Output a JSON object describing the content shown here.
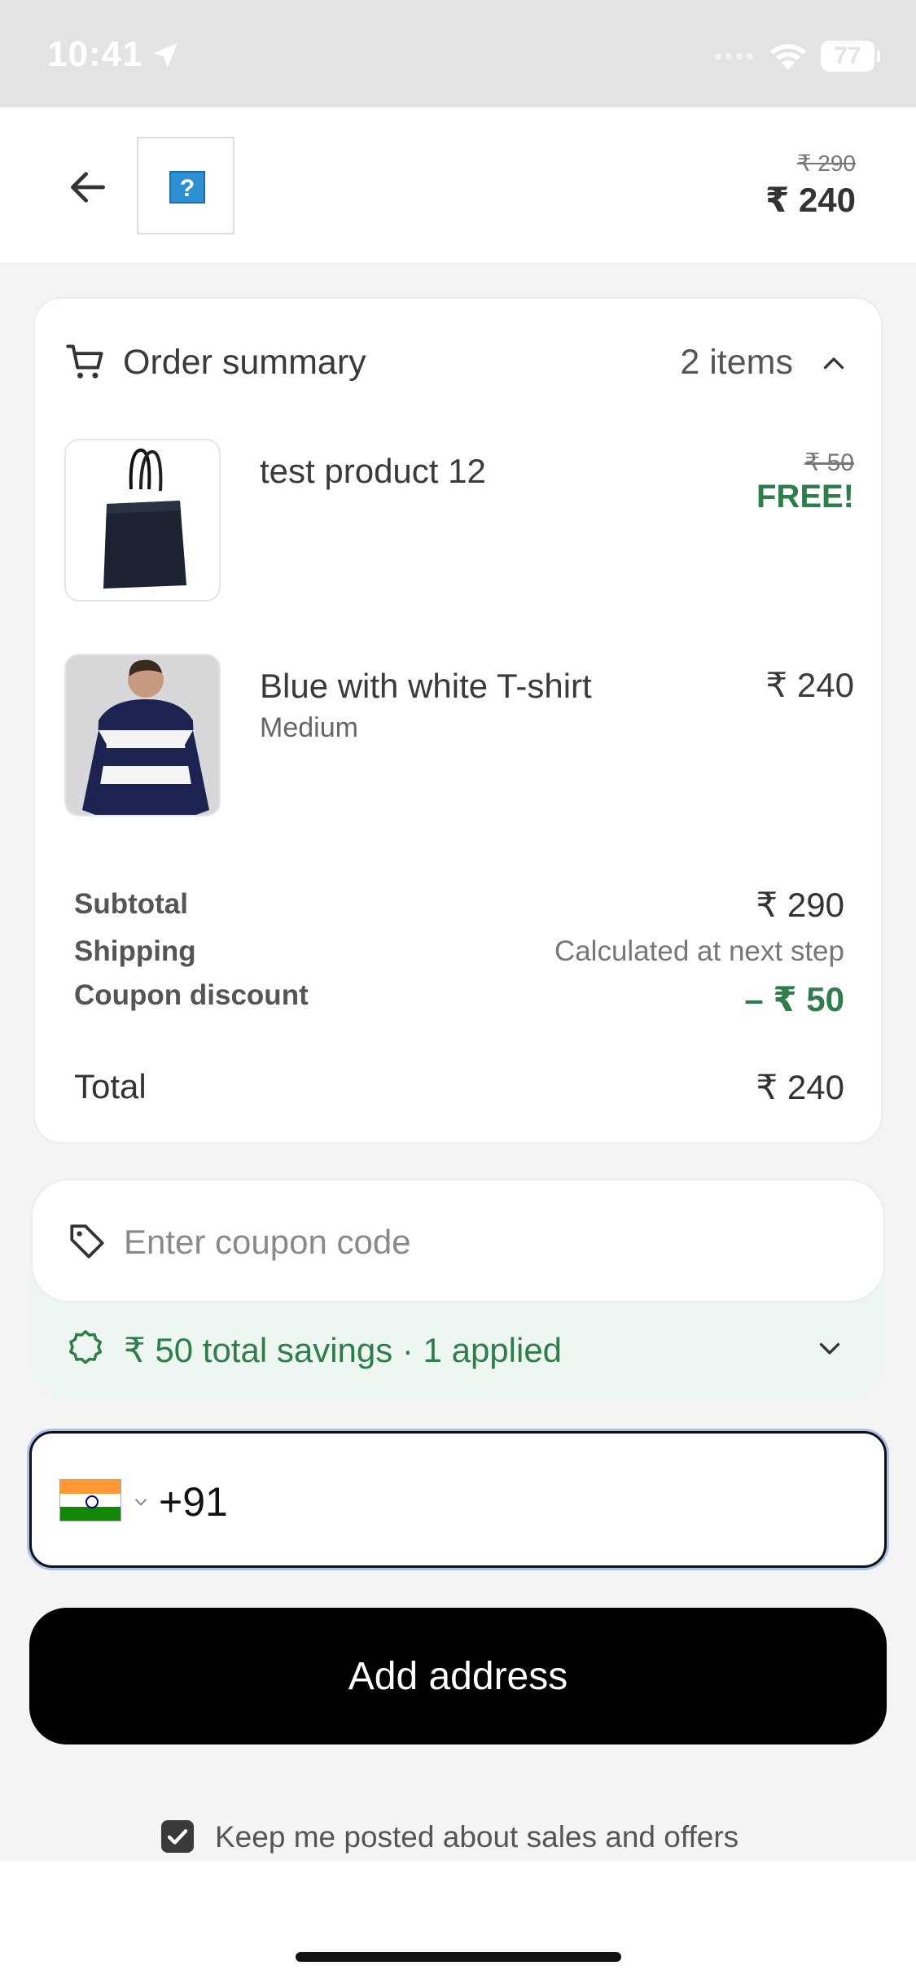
{
  "status_bar": {
    "time": "10:41",
    "battery": "77"
  },
  "header": {
    "original_price": "₹ 290",
    "total_price": "₹ 240",
    "logo_glyph": "?"
  },
  "summary": {
    "title": "Order summary",
    "items_count": "2 items",
    "products": [
      {
        "name": "test product 12",
        "variant": "",
        "original_price": "₹ 50",
        "price": "FREE!"
      },
      {
        "name": "Blue with white T-shirt",
        "variant": "Medium",
        "original_price": "",
        "price": "₹ 240"
      }
    ],
    "subtotal_label": "Subtotal",
    "subtotal_value": "₹ 290",
    "shipping_label": "Shipping",
    "shipping_value": "Calculated at next step",
    "coupon_label": "Coupon discount",
    "coupon_value": "– ₹ 50",
    "total_label": "Total",
    "total_value": "₹ 240"
  },
  "coupon": {
    "placeholder": "Enter coupon code",
    "savings_text": "₹ 50 total savings · 1 applied"
  },
  "phone": {
    "country": "India",
    "value": "+91"
  },
  "actions": {
    "add_address_label": "Add address"
  },
  "optin": {
    "label": "Keep me posted about sales and offers",
    "checked": true
  },
  "colors": {
    "accent_green": "#2e7d4a",
    "button_black": "#000000",
    "focus_ring": "#a9c1ee"
  }
}
